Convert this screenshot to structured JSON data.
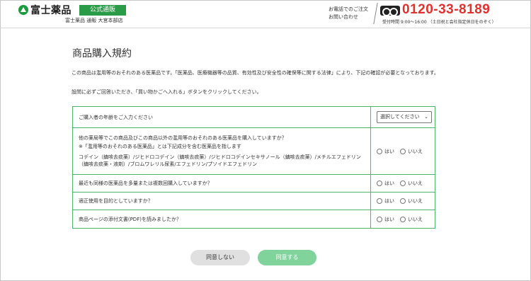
{
  "header": {
    "logo": "富士薬品",
    "official_badge": "公式通販",
    "subtitle": "富士薬品 通販 大宮本部店",
    "phone_note_line1": "お電話でのご注文",
    "phone_note_line2": "お問い合わせ",
    "phone_number": "0120-33-8189",
    "phone_hours": "受付時間 9:00〜16:00 （土日祝と会社指定休日をのぞく）",
    "freedial_icon": "freedial-icon"
  },
  "main": {
    "title": "商品購入規約",
    "intro": "この商品は濫用等のおそれのある医薬品です。「医薬品、医療機器等の品質、有効性及び安全性の確保等に関する法律」により、下記の確認が必要となっております。",
    "instruction": "設問に必ずご回答いただき、「買い物かごへ入れる」ボタンをクリックしてください。"
  },
  "questions": [
    {
      "text": "ご購入者の年齢をご入力ください",
      "select": "選択してください"
    },
    {
      "text": "他の薬局等でこの商品及びこの商品以外の濫用等のおそれのある医薬品を購入していますか？",
      "note": "※「濫用等のおそれのある医薬品」とは下記成分を含む医薬品を指します",
      "ingredients": "コデイン（鎮咳去痰薬）/ジヒドロコデイン（鎮咳去痰薬）/ジヒドロコデインセキサノール（鎮咳去痰薬）/メチルエフェドリン（鎮咳去痰薬・液剤）/ブロムワレリル尿素/エフェドリン/プソイドエフェドリン",
      "yes": "はい",
      "no": "いいえ"
    },
    {
      "text": "最近も同様の医薬品を多量または複数回購入していますか？",
      "yes": "はい",
      "no": "いいえ"
    },
    {
      "text": "適正使用を目的としていますか？",
      "yes": "はい",
      "no": "いいえ"
    },
    {
      "text": "商品ページの添付文書(PDF)を読みましたか？",
      "yes": "はい",
      "no": "いいえ"
    }
  ],
  "buttons": {
    "disagree": "同意しない",
    "agree": "同意する"
  },
  "colors": {
    "brand_green": "#2a9b46",
    "table_border": "#4cb66a",
    "phone_red": "#e0312f",
    "agree_button": "#7fd39b"
  }
}
